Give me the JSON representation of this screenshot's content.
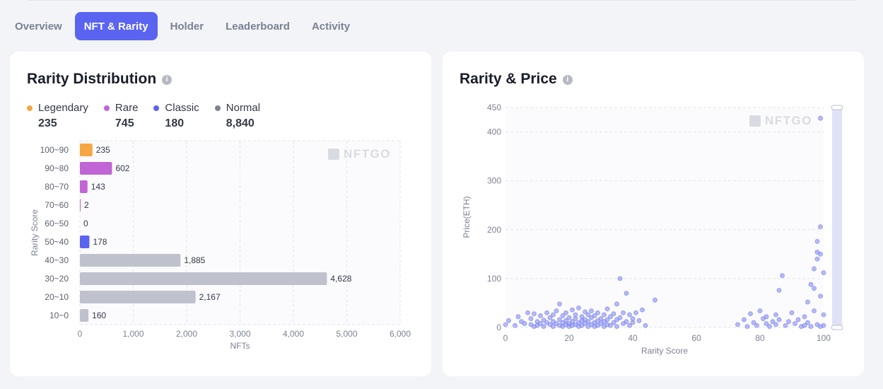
{
  "tabs": [
    {
      "label": "Overview",
      "active": false
    },
    {
      "label": "NFT & Rarity",
      "active": true
    },
    {
      "label": "Holder",
      "active": false
    },
    {
      "label": "Leaderboard",
      "active": false
    },
    {
      "label": "Activity",
      "active": false
    }
  ],
  "watermark": "NFTGO",
  "info_icon_glyph": "i",
  "rarity_distribution": {
    "title": "Rarity Distribution",
    "legend": [
      {
        "label": "Legendary",
        "count": "235",
        "color": "#f7a642"
      },
      {
        "label": "Rare",
        "count": "745",
        "color": "#c064d6"
      },
      {
        "label": "Classic",
        "count": "180",
        "color": "#5a64f0"
      },
      {
        "label": "Normal",
        "count": "8,840",
        "color": "#7d8294"
      }
    ]
  },
  "rarity_price": {
    "title": "Rarity & Price"
  },
  "chart_data": [
    {
      "type": "bar",
      "orientation": "horizontal",
      "categories": [
        "100~90",
        "90~80",
        "80~70",
        "70~60",
        "60~50",
        "50~40",
        "40~30",
        "30~20",
        "20~10",
        "10~0"
      ],
      "values": [
        235,
        602,
        143,
        2,
        0,
        178,
        1885,
        4628,
        2167,
        160
      ],
      "value_labels": [
        "235",
        "602",
        "143",
        "2",
        "0",
        "178",
        "1,885",
        "4,628",
        "2,167",
        "160"
      ],
      "colors": [
        "#f7a642",
        "#c064d6",
        "#c064d6",
        "#c064d6",
        "#c064d6",
        "#5a64f0",
        "#bfc1cc",
        "#bfc1cc",
        "#bfc1cc",
        "#bfc1cc"
      ],
      "xlabel": "NFTs",
      "ylabel": "Rarity Score",
      "xlim": [
        0,
        6000
      ],
      "xticks": [
        0,
        1000,
        2000,
        3000,
        4000,
        5000,
        6000
      ],
      "xtick_labels": [
        "0",
        "1,000",
        "2,000",
        "3,000",
        "4,000",
        "5,000",
        "6,000"
      ],
      "grid": true
    },
    {
      "type": "scatter",
      "xlabel": "Rarity Score",
      "ylabel": "Price(ETH)",
      "xlim": [
        0,
        100
      ],
      "ylim": [
        0,
        450
      ],
      "xticks": [
        0,
        20,
        40,
        60,
        80,
        100
      ],
      "yticks": [
        0,
        100,
        200,
        300,
        400,
        450
      ],
      "grid": true,
      "zoom_slider": "right",
      "point_color": "#7b83f0",
      "points": [
        [
          0,
          6
        ],
        [
          1,
          14
        ],
        [
          3,
          4
        ],
        [
          4,
          22
        ],
        [
          5,
          12
        ],
        [
          6,
          8
        ],
        [
          7,
          30
        ],
        [
          8,
          18
        ],
        [
          8,
          6
        ],
        [
          9,
          2
        ],
        [
          9,
          28
        ],
        [
          10,
          12
        ],
        [
          10,
          4
        ],
        [
          11,
          24
        ],
        [
          11,
          8
        ],
        [
          12,
          15
        ],
        [
          12,
          2
        ],
        [
          13,
          30
        ],
        [
          13,
          10
        ],
        [
          14,
          6
        ],
        [
          14,
          20
        ],
        [
          15,
          2
        ],
        [
          15,
          26
        ],
        [
          15,
          12
        ],
        [
          16,
          8
        ],
        [
          16,
          34
        ],
        [
          17,
          4
        ],
        [
          17,
          16
        ],
        [
          17,
          48
        ],
        [
          18,
          10
        ],
        [
          18,
          24
        ],
        [
          18,
          2
        ],
        [
          19,
          14
        ],
        [
          19,
          30
        ],
        [
          19,
          6
        ],
        [
          20,
          8
        ],
        [
          20,
          20
        ],
        [
          20,
          2
        ],
        [
          21,
          36
        ],
        [
          21,
          12
        ],
        [
          21,
          4
        ],
        [
          22,
          18
        ],
        [
          22,
          6
        ],
        [
          22,
          26
        ],
        [
          23,
          10
        ],
        [
          23,
          2
        ],
        [
          23,
          40
        ],
        [
          24,
          14
        ],
        [
          24,
          22
        ],
        [
          24,
          4
        ],
        [
          25,
          8
        ],
        [
          25,
          32
        ],
        [
          25,
          16
        ],
        [
          26,
          2
        ],
        [
          26,
          12
        ],
        [
          26,
          26
        ],
        [
          27,
          6
        ],
        [
          27,
          20
        ],
        [
          27,
          34
        ],
        [
          28,
          10
        ],
        [
          28,
          2
        ],
        [
          28,
          24
        ],
        [
          29,
          14
        ],
        [
          29,
          30
        ],
        [
          29,
          4
        ],
        [
          30,
          8
        ],
        [
          30,
          18
        ],
        [
          31,
          2
        ],
        [
          31,
          26
        ],
        [
          31,
          12
        ],
        [
          32,
          16
        ],
        [
          32,
          6
        ],
        [
          32,
          38
        ],
        [
          33,
          22
        ],
        [
          33,
          4
        ],
        [
          34,
          10
        ],
        [
          34,
          28
        ],
        [
          35,
          48
        ],
        [
          35,
          16
        ],
        [
          35,
          2
        ],
        [
          36,
          20
        ],
        [
          36,
          100
        ],
        [
          37,
          30
        ],
        [
          37,
          8
        ],
        [
          38,
          70
        ],
        [
          38,
          12
        ],
        [
          39,
          26
        ],
        [
          39,
          4
        ],
        [
          40,
          10
        ],
        [
          40,
          18
        ],
        [
          41,
          30
        ],
        [
          42,
          14
        ],
        [
          43,
          36
        ],
        [
          44,
          4
        ],
        [
          47,
          56
        ],
        [
          73,
          6
        ],
        [
          75,
          16
        ],
        [
          76,
          2
        ],
        [
          77,
          28
        ],
        [
          78,
          10
        ],
        [
          79,
          4
        ],
        [
          80,
          34
        ],
        [
          81,
          18
        ],
        [
          82,
          8
        ],
        [
          82,
          22
        ],
        [
          83,
          2
        ],
        [
          84,
          12
        ],
        [
          85,
          26
        ],
        [
          85,
          6
        ],
        [
          86,
          76
        ],
        [
          86,
          16
        ],
        [
          87,
          106
        ],
        [
          88,
          4
        ],
        [
          89,
          12
        ],
        [
          90,
          30
        ],
        [
          91,
          8
        ],
        [
          92,
          16
        ],
        [
          93,
          2
        ],
        [
          94,
          22
        ],
        [
          94,
          4
        ],
        [
          95,
          52
        ],
        [
          95,
          10
        ],
        [
          96,
          88
        ],
        [
          96,
          2
        ],
        [
          97,
          80
        ],
        [
          97,
          34
        ],
        [
          97,
          120
        ],
        [
          98,
          140
        ],
        [
          98,
          154
        ],
        [
          98,
          176
        ],
        [
          98,
          6
        ],
        [
          99,
          206
        ],
        [
          99,
          150
        ],
        [
          99,
          64
        ],
        [
          99,
          2
        ],
        [
          99,
          428
        ],
        [
          100,
          112
        ],
        [
          100,
          26
        ],
        [
          100,
          4
        ]
      ]
    }
  ]
}
